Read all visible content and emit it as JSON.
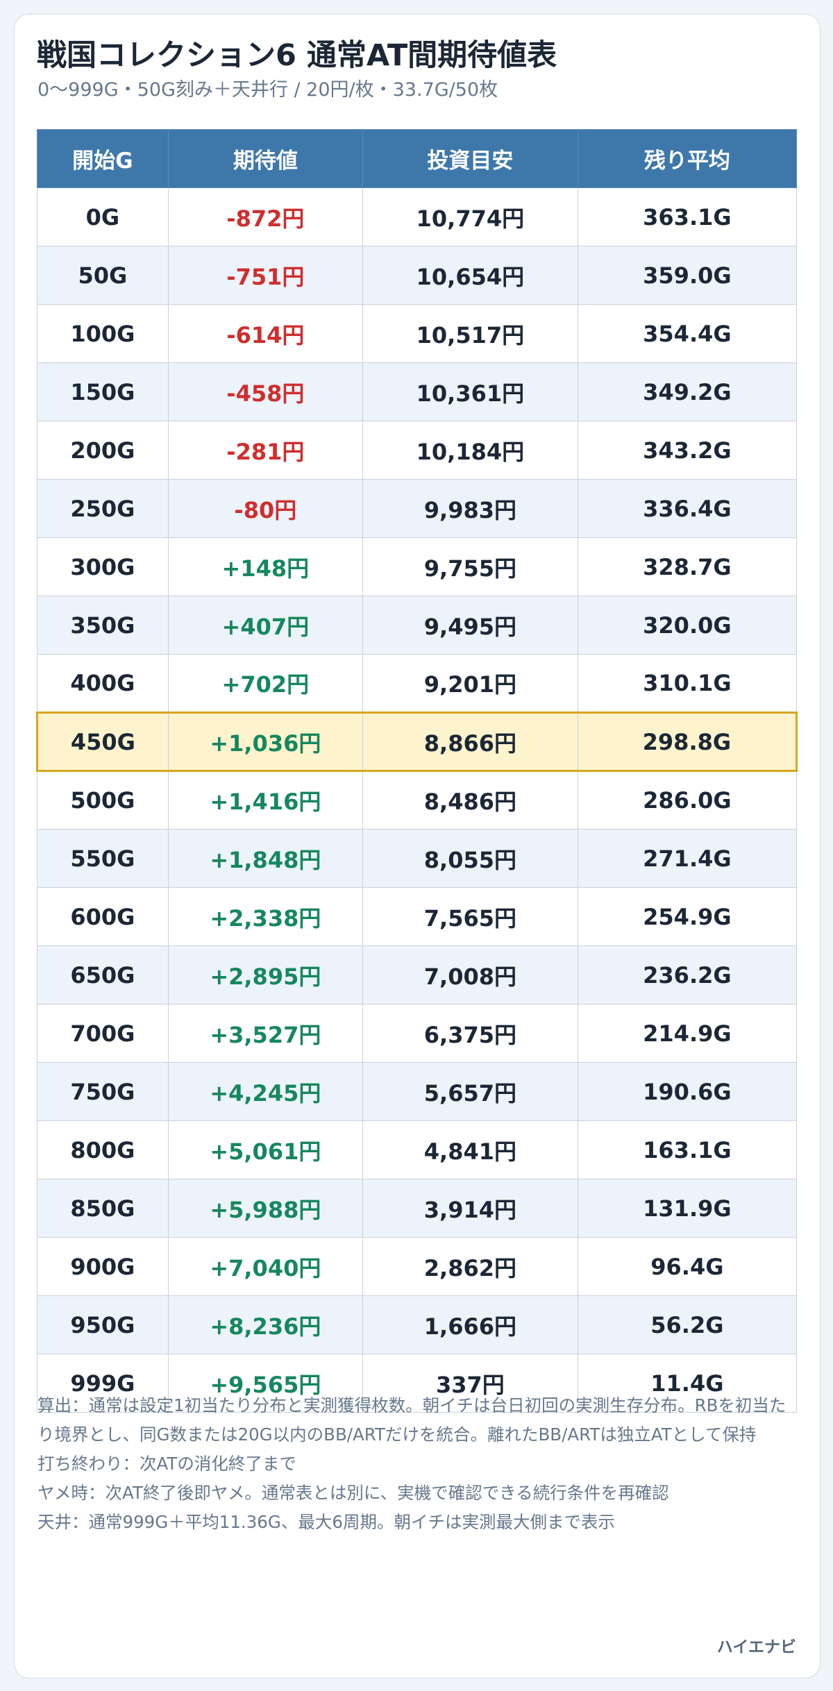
{
  "title": "戦国コレクション6 通常AT間期待値表",
  "subtitle": "0〜999G・50G刻み＋天井行 / 20円/枚・33.7G/50枚",
  "table": {
    "headers": [
      "開始G",
      "期待値",
      "投資目安",
      "残り平均"
    ],
    "rows": [
      {
        "start": "0G",
        "ev": "-872円",
        "sign": "neg",
        "invest": "10,774円",
        "remain": "363.1G"
      },
      {
        "start": "50G",
        "ev": "-751円",
        "sign": "neg",
        "invest": "10,654円",
        "remain": "359.0G"
      },
      {
        "start": "100G",
        "ev": "-614円",
        "sign": "neg",
        "invest": "10,517円",
        "remain": "354.4G"
      },
      {
        "start": "150G",
        "ev": "-458円",
        "sign": "neg",
        "invest": "10,361円",
        "remain": "349.2G"
      },
      {
        "start": "200G",
        "ev": "-281円",
        "sign": "neg",
        "invest": "10,184円",
        "remain": "343.2G"
      },
      {
        "start": "250G",
        "ev": "-80円",
        "sign": "neg",
        "invest": "9,983円",
        "remain": "336.4G"
      },
      {
        "start": "300G",
        "ev": "+148円",
        "sign": "pos",
        "invest": "9,755円",
        "remain": "328.7G"
      },
      {
        "start": "350G",
        "ev": "+407円",
        "sign": "pos",
        "invest": "9,495円",
        "remain": "320.0G"
      },
      {
        "start": "400G",
        "ev": "+702円",
        "sign": "pos",
        "invest": "9,201円",
        "remain": "310.1G"
      },
      {
        "start": "450G",
        "ev": "+1,036円",
        "sign": "pos",
        "invest": "8,866円",
        "remain": "298.8G",
        "highlight": true
      },
      {
        "start": "500G",
        "ev": "+1,416円",
        "sign": "pos",
        "invest": "8,486円",
        "remain": "286.0G"
      },
      {
        "start": "550G",
        "ev": "+1,848円",
        "sign": "pos",
        "invest": "8,055円",
        "remain": "271.4G"
      },
      {
        "start": "600G",
        "ev": "+2,338円",
        "sign": "pos",
        "invest": "7,565円",
        "remain": "254.9G"
      },
      {
        "start": "650G",
        "ev": "+2,895円",
        "sign": "pos",
        "invest": "7,008円",
        "remain": "236.2G"
      },
      {
        "start": "700G",
        "ev": "+3,527円",
        "sign": "pos",
        "invest": "6,375円",
        "remain": "214.9G"
      },
      {
        "start": "750G",
        "ev": "+4,245円",
        "sign": "pos",
        "invest": "5,657円",
        "remain": "190.6G"
      },
      {
        "start": "800G",
        "ev": "+5,061円",
        "sign": "pos",
        "invest": "4,841円",
        "remain": "163.1G"
      },
      {
        "start": "850G",
        "ev": "+5,988円",
        "sign": "pos",
        "invest": "3,914円",
        "remain": "131.9G"
      },
      {
        "start": "900G",
        "ev": "+7,040円",
        "sign": "pos",
        "invest": "2,862円",
        "remain": "96.4G"
      },
      {
        "start": "950G",
        "ev": "+8,236円",
        "sign": "pos",
        "invest": "1,666円",
        "remain": "56.2G"
      },
      {
        "start": "999G",
        "ev": "+9,565円",
        "sign": "pos",
        "invest": "337円",
        "remain": "11.4G"
      }
    ]
  },
  "notes": [
    "算出：通常は設定1初当たり分布と実測獲得枚数。朝イチは台日初回の実測生存分布。RBを初当たり境界とし、同G数または20G以内のBB/ARTだけを統合。離れたBB/ARTは独立ATとして保持",
    "打ち終わり：次ATの消化終了まで",
    "ヤメ時：次AT終了後即ヤメ。通常表とは別に、実機で確認できる続行条件を再確認",
    "天井：通常999G＋平均11.36G、最大6周期。朝イチは実測最大側まで表示"
  ],
  "brand": "ハイエナビ",
  "colors": {
    "header_bg": "#3e78ab",
    "negative": "#cf2e2e",
    "positive": "#16875e",
    "highlight_bg": "#fdf4cd",
    "highlight_border": "#d8a520"
  }
}
